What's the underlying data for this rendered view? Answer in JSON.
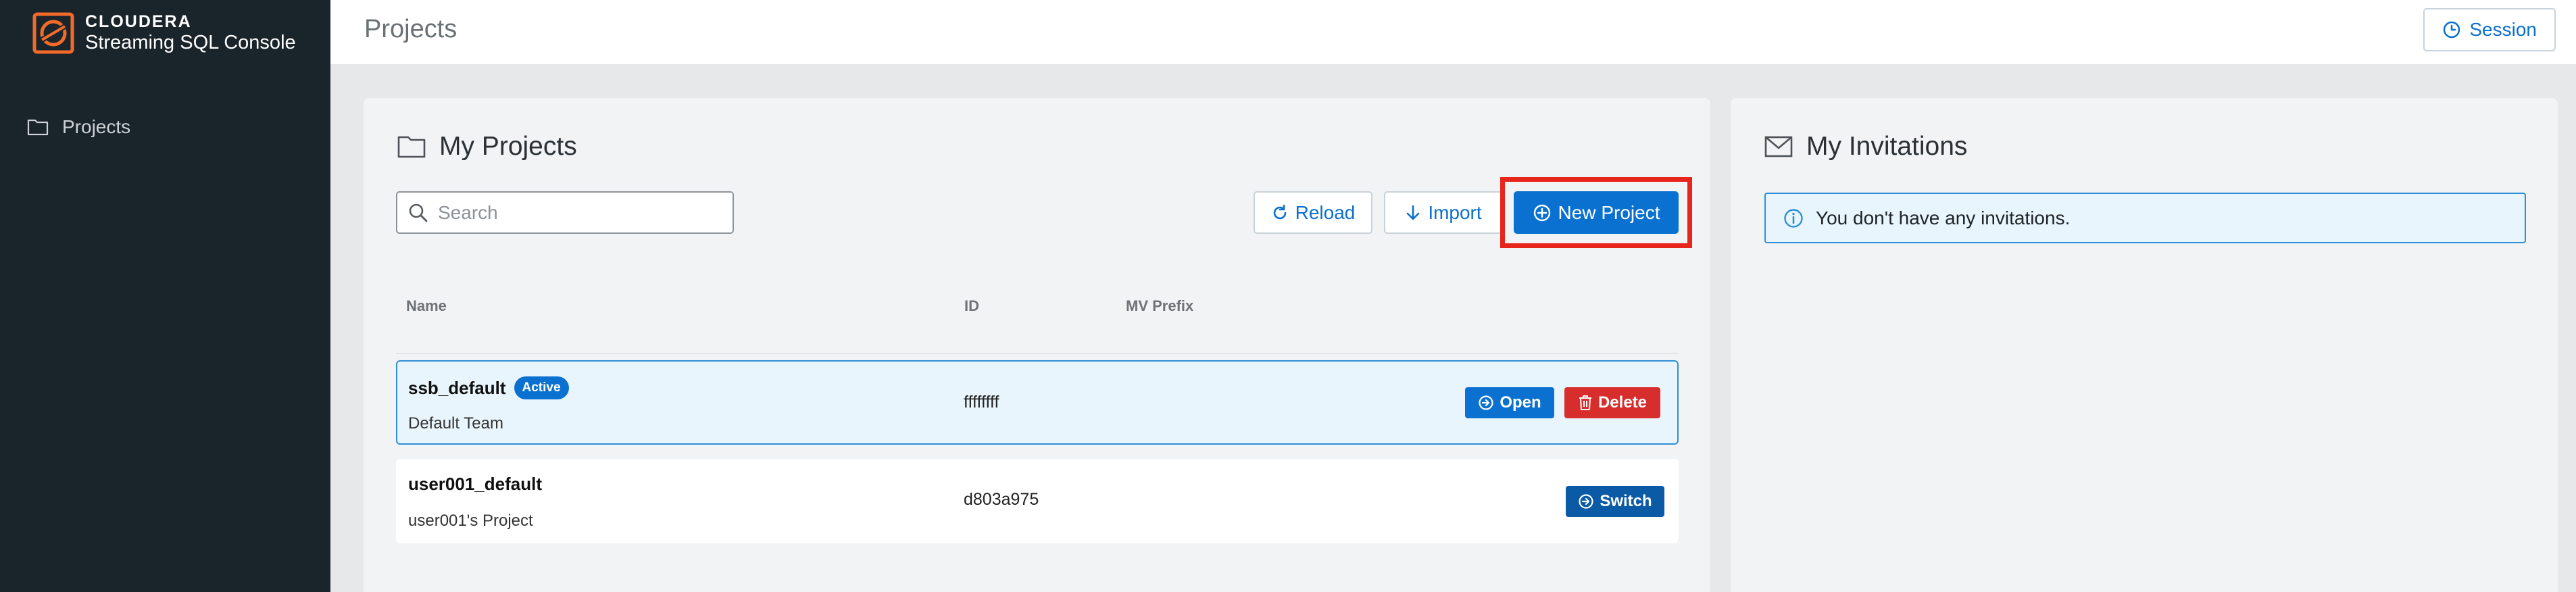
{
  "brand": {
    "name": "CLOUDERA",
    "product": "Streaming SQL Console"
  },
  "sidebar": {
    "items": [
      {
        "label": "Projects",
        "icon": "folder-icon"
      }
    ]
  },
  "header": {
    "title": "Projects",
    "session_label": "Session"
  },
  "my_projects": {
    "title": "My Projects",
    "search_placeholder": "Search",
    "reload_label": "Reload",
    "import_label": "Import",
    "new_project_label": "New Project",
    "columns": [
      "Name",
      "ID",
      "MV Prefix"
    ],
    "rows": [
      {
        "name": "ssb_default",
        "badge": "Active",
        "team": "Default Team",
        "id": "ffffffff",
        "mv_prefix": "",
        "actions": [
          "Open",
          "Delete"
        ]
      },
      {
        "name": "user001_default",
        "badge": "",
        "team": "user001's Project",
        "id": "d803a975",
        "mv_prefix": "",
        "actions": [
          "Switch"
        ]
      }
    ]
  },
  "invitations": {
    "title": "My Invitations",
    "empty_message": "You don't have any invitations."
  },
  "colors": {
    "sidebar_bg": "#1a252b",
    "brand_accent": "#f26b2b",
    "primary": "#0b71d1",
    "danger": "#d82d2d",
    "highlight": "#e8251c"
  }
}
